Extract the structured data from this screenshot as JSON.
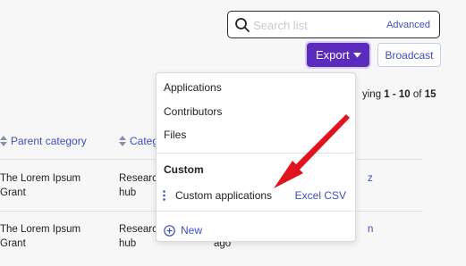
{
  "search": {
    "placeholder": "Search list",
    "advanced_label": "Advanced"
  },
  "toolbar": {
    "export_label": "Export",
    "broadcast_label": "Broadcast"
  },
  "paging": {
    "prefix": "ying ",
    "range": "1 - 10",
    "of_text": " of ",
    "total": "15"
  },
  "table": {
    "columns": [
      {
        "label": "Parent category"
      },
      {
        "label": "Categ"
      }
    ],
    "rows": [
      {
        "parent_line1": "The Lorem Ipsum",
        "parent_line2": "Grant",
        "category_line1": "Researc",
        "category_line2": "hub",
        "extra": "z"
      },
      {
        "parent_line1": "The Lorem Ipsum",
        "parent_line2": "Grant",
        "category_line1": "Researc",
        "category_line2": "hub",
        "extra": "n",
        "extra2": "ago"
      }
    ]
  },
  "export_menu": {
    "items": [
      {
        "label": "Applications"
      },
      {
        "label": "Contributors"
      },
      {
        "label": "Files"
      }
    ],
    "custom_heading": "Custom",
    "custom_item": {
      "label": "Custom applications",
      "format": "Excel CSV"
    },
    "new_label": "New"
  },
  "colors": {
    "accent": "#5b2bbd",
    "link": "#3d4fbf",
    "annotation_arrow": "#e0141e"
  },
  "icons": [
    "search-icon",
    "caret-down-icon",
    "sort-icon",
    "drag-handle-icon",
    "plus-circle-icon",
    "annotation-arrow"
  ]
}
